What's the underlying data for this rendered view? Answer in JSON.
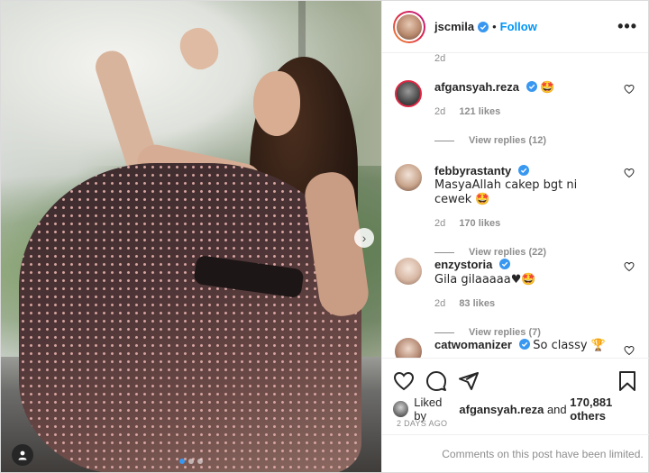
{
  "post": {
    "author": "jscmila",
    "follow_label": "Follow",
    "separator": "•",
    "more_label": "•••",
    "top_timestamp": "2d",
    "photo_nav_next": "›",
    "photo_dots": 3,
    "active_dot": 0
  },
  "comments": [
    {
      "user": "afgansyah.reza",
      "text": "🤩",
      "age": "2d",
      "likes": "121 likes",
      "replies": "View replies (12)",
      "avatar_color": "#5a5a5a"
    },
    {
      "user": "febbyrastanty",
      "text": "MasyaAllah cakep bgt ni cewek 🤩",
      "age": "2d",
      "likes": "170 likes",
      "replies": "View replies (22)",
      "avatar_color": "#c9a58c"
    },
    {
      "user": "enzystoria",
      "text": "Gila gilaaaaa♥🤩",
      "age": "2d",
      "likes": "83 likes",
      "replies": "View replies (7)",
      "avatar_color": "#d8b8a4"
    },
    {
      "user": "catwomanizer",
      "text": "So classy 🏆",
      "avatar_color": "#b58a74"
    }
  ],
  "actions": {
    "like_icon": "heart-outline-icon",
    "comment_icon": "comment-bubble-icon",
    "share_icon": "paper-plane-icon",
    "save_icon": "bookmark-icon"
  },
  "liked_by": {
    "prefix": "Liked by",
    "user": "afgansyah.reza",
    "and": "and",
    "others": "170,881 others"
  },
  "date": "2 DAYS AGO",
  "comments_limited": "Comments on this post have been limited.",
  "colors": {
    "accent": "#0095f6",
    "verified": "#3897f0",
    "muted": "#8e8e8e",
    "text": "#262626"
  }
}
